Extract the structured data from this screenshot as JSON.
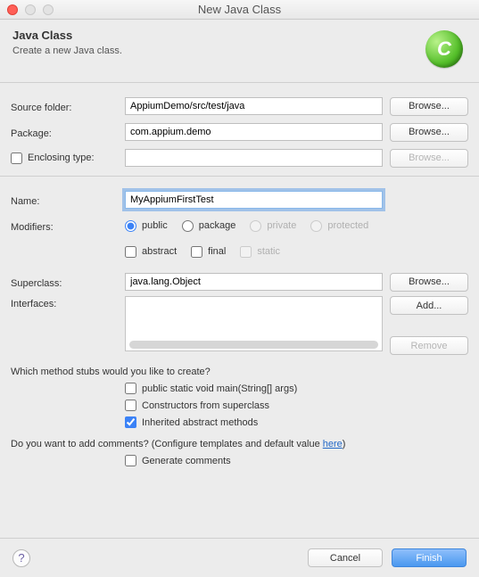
{
  "window": {
    "title": "New Java Class"
  },
  "header": {
    "title": "Java Class",
    "subtitle": "Create a new Java class.",
    "iconLetter": "C"
  },
  "labels": {
    "sourceFolder": "Source folder:",
    "package": "Package:",
    "enclosingType": "Enclosing type:",
    "name": "Name:",
    "modifiers": "Modifiers:",
    "superclass": "Superclass:",
    "interfaces": "Interfaces:"
  },
  "fields": {
    "sourceFolder": "AppiumDemo/src/test/java",
    "package": "com.appium.demo",
    "enclosingType": "",
    "name": "MyAppiumFirstTest",
    "superclass": "java.lang.Object"
  },
  "modifiers": {
    "public": "public",
    "package": "package",
    "private": "private",
    "protected": "protected",
    "abstract": "abstract",
    "final": "final",
    "static": "static"
  },
  "buttons": {
    "browse": "Browse...",
    "add": "Add...",
    "remove": "Remove",
    "cancel": "Cancel",
    "finish": "Finish"
  },
  "methodStubs": {
    "question": "Which method stubs would you like to create?",
    "main": "public static void main(String[] args)",
    "constructors": "Constructors from superclass",
    "inherited": "Inherited abstract methods"
  },
  "comments": {
    "prefix": "Do you want to add comments? (Configure templates and default value ",
    "link": "here",
    "suffix": ")",
    "generate": "Generate comments"
  }
}
